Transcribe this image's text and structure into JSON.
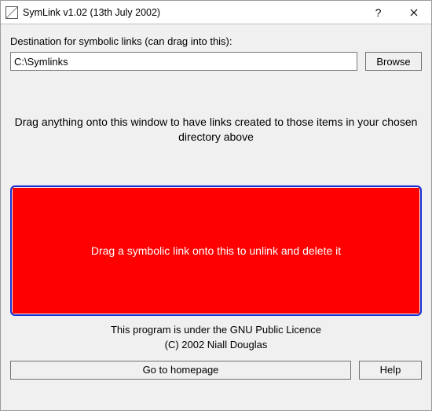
{
  "titlebar": {
    "title": "SymLink v1.02 (13th July 2002)"
  },
  "dest": {
    "label": "Destination for symbolic links (can drag into this):",
    "value": "C:\\Symlinks",
    "browse": "Browse"
  },
  "instructions": {
    "drag_create": "Drag anything onto this window to have links created to those items in your chosen directory above",
    "drag_delete": "Drag a symbolic link onto this to unlink and delete it"
  },
  "footer": {
    "license": "This program is under the GNU Public Licence",
    "copyright": "(C) 2002 Niall Douglas"
  },
  "buttons": {
    "homepage": "Go to homepage",
    "help": "Help"
  }
}
